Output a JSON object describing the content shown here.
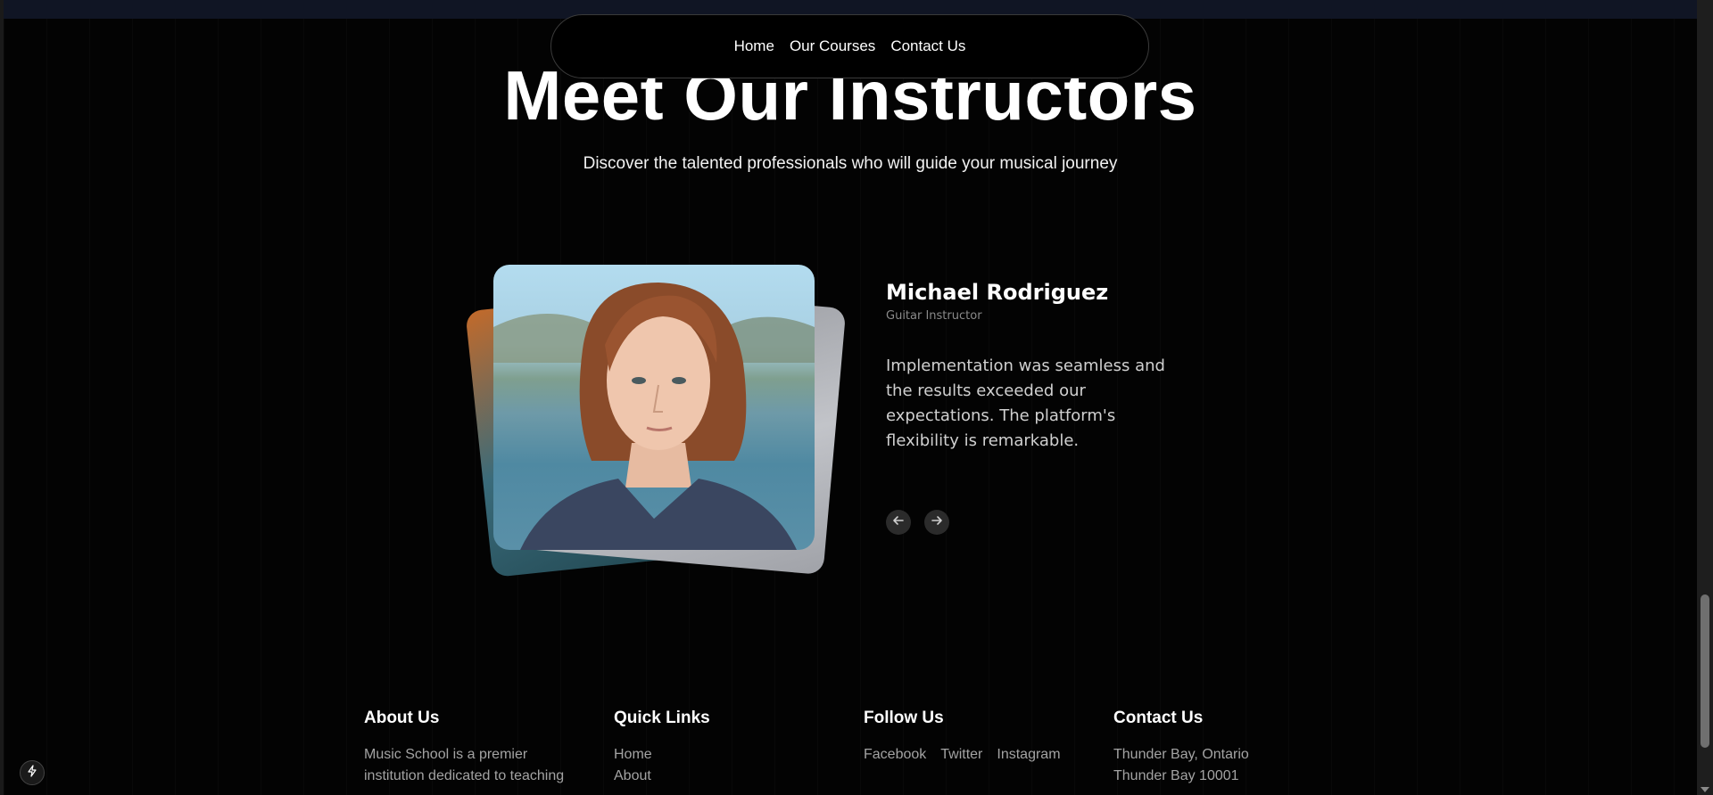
{
  "nav": {
    "items": [
      {
        "label": "Home"
      },
      {
        "label": "Our Courses"
      },
      {
        "label": "Contact Us"
      }
    ]
  },
  "section": {
    "title": "Meet Our Instructors",
    "subtitle": "Discover the talented professionals who will guide your musical journey"
  },
  "instructor": {
    "name": "Michael Rodriguez",
    "role": "Guitar Instructor",
    "quote": "Implementation was seamless and the results exceeded our expectations. The platform's flexibility is remarkable."
  },
  "carousel": {
    "prev_icon": "arrow-left-icon",
    "next_icon": "arrow-right-icon"
  },
  "footer": {
    "about": {
      "heading": "About Us",
      "text": "Music School is a premier institution dedicated to teaching"
    },
    "quick_links": {
      "heading": "Quick Links",
      "items": [
        {
          "label": "Home"
        },
        {
          "label": "About"
        }
      ]
    },
    "follow": {
      "heading": "Follow Us",
      "items": [
        {
          "label": "Facebook"
        },
        {
          "label": "Twitter"
        },
        {
          "label": "Instagram"
        }
      ]
    },
    "contact": {
      "heading": "Contact Us",
      "lines": [
        "Thunder Bay, Ontario",
        "Thunder Bay 10001"
      ]
    }
  },
  "colors": {
    "background": "#030303",
    "top_strip": "#101524",
    "muted_text": "#a3a3a3"
  }
}
